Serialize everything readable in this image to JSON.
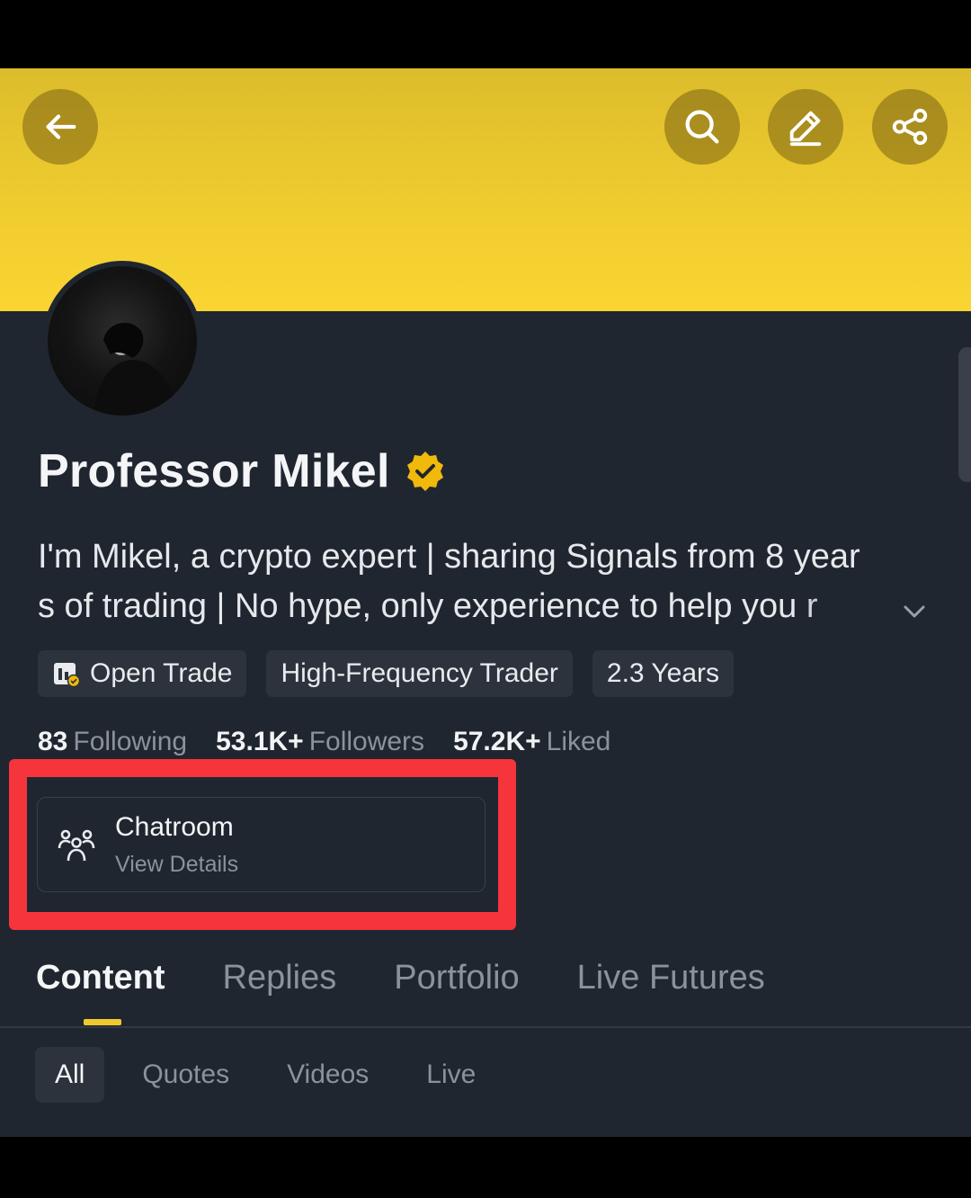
{
  "header": {
    "back_icon": "arrow-left-icon",
    "actions": [
      "search-icon",
      "edit-pencil-icon",
      "share-icon"
    ],
    "banner_color": "#f0cd2e"
  },
  "profile": {
    "name": "Professor Mikel",
    "verified_icon": "verified-badge-icon",
    "bio_line1": "I'm Mikel, a crypto expert | sharing Signals from 8 year",
    "bio_line2": "s of trading | No hype, only experience to help you r",
    "tags": {
      "open_trade": "Open Trade",
      "trader_type": "High-Frequency Trader",
      "experience": "2.3 Years"
    },
    "stats": {
      "following_count": "83",
      "following_label": "Following",
      "followers_count": "53.1K+",
      "followers_label": "Followers",
      "liked_count": "57.2K+",
      "liked_label": "Liked"
    }
  },
  "chatroom": {
    "title": "Chatroom",
    "subtitle": "View Details",
    "icon": "group-users-icon",
    "highlight_color": "#f5343c"
  },
  "tabs": {
    "content": "Content",
    "replies": "Replies",
    "portfolio": "Portfolio",
    "live_futures": "Live Futures",
    "active": "Content",
    "accent_color": "#f0c92e"
  },
  "filters": {
    "all": "All",
    "quotes": "Quotes",
    "videos": "Videos",
    "live": "Live",
    "active": "All"
  }
}
